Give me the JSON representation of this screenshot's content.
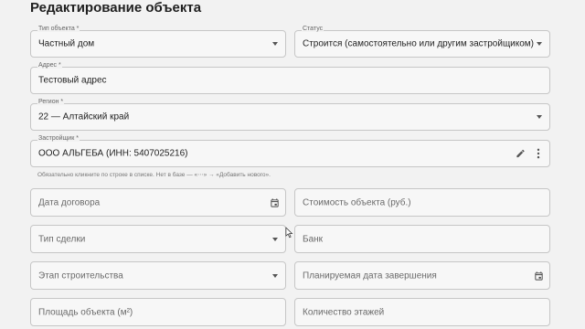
{
  "page": {
    "title": "Редактирование объекта"
  },
  "form": {
    "object_type": {
      "label": "Тип объекта *",
      "value": "Частный дом"
    },
    "status": {
      "label": "Статус",
      "value": "Строится (самостоятельно или другим застройщиком)"
    },
    "address": {
      "label": "Адрес *",
      "value": "Тестовый адрес"
    },
    "region": {
      "label": "Регион *",
      "value": "22 — Алтайский край"
    },
    "developer": {
      "label": "Застройщик *",
      "value": "ООО АЛЬГЕБА (ИНН: 5407025216)",
      "hint": "Обязательно кликните по строке в списке. Нет в базе — «⋯» → «Добавить нового»."
    },
    "contract_date": {
      "placeholder": "Дата договора"
    },
    "object_cost": {
      "placeholder": "Стоимость объекта (руб.)"
    },
    "deal_type": {
      "placeholder": "Тип сделки"
    },
    "bank": {
      "placeholder": "Банк"
    },
    "construction_stage": {
      "placeholder": "Этап строительства"
    },
    "planned_completion": {
      "placeholder": "Планируемая дата завершения"
    },
    "object_area": {
      "placeholder": "Площадь объекта (м²)"
    },
    "floors_count": {
      "placeholder": "Количество этажей"
    }
  },
  "icons": {
    "dropdown": "chevron-down-icon",
    "date": "calendar-icon",
    "edit": "pencil-icon",
    "more": "more-vertical-icon"
  },
  "colors": {
    "background": "#f2f2f2",
    "border": "#c6c6c6",
    "text": "#222222",
    "label": "#666666"
  }
}
